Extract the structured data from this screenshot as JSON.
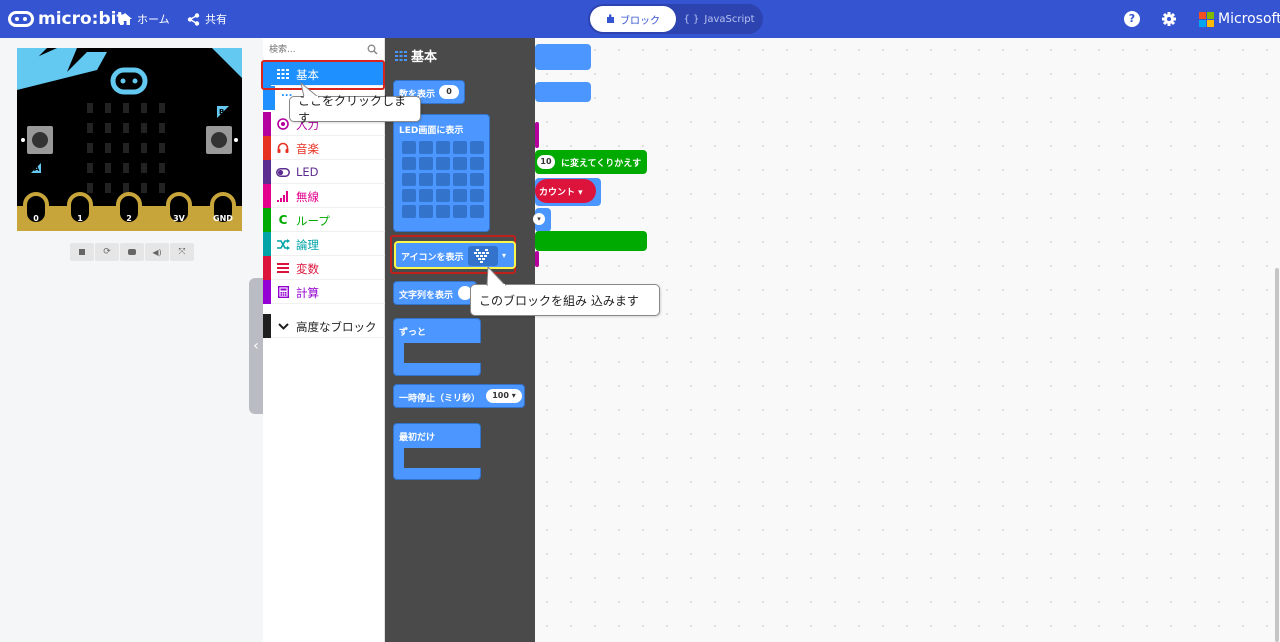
{
  "colors": {
    "topbar": "#3454d1",
    "basic": "#1e90ff",
    "input": "#b4009e",
    "music": "#e63022",
    "led": "#5c2d91",
    "radio": "#e3008c",
    "loops": "#00aa00",
    "logic": "#00a4a6",
    "variables": "#dc143c",
    "math": "#9400d3",
    "advanced": "#1f1f1f",
    "highlight": "#d9231f"
  },
  "header": {
    "logo": "micro:bit",
    "home_label": "ホーム",
    "share_label": "共有",
    "mode_blocks": "ブロック",
    "mode_js": "JavaScript",
    "brand": "Microsoft"
  },
  "simulator": {
    "pin_labels": [
      "0",
      "1",
      "2",
      "3V",
      "GND"
    ],
    "button_a": "A",
    "button_b": "B",
    "controls": [
      "stop-icon",
      "restart-icon",
      "debug-icon",
      "mute-icon",
      "fullscreen-icon"
    ]
  },
  "toolbox": {
    "search_placeholder": "検索...",
    "categories": [
      {
        "label": "基本",
        "icon": "grid-icon",
        "color": "#1e90ff"
      },
      {
        "label": "入力",
        "icon": "target-icon",
        "color": "#b4009e"
      },
      {
        "label": "音楽",
        "icon": "headphones-icon",
        "color": "#e63022"
      },
      {
        "label": "LED",
        "icon": "toggle-icon",
        "color": "#5c2d91"
      },
      {
        "label": "無線",
        "icon": "signal-icon",
        "color": "#e3008c"
      },
      {
        "label": "ループ",
        "icon": "refresh-icon",
        "color": "#00aa00"
      },
      {
        "label": "論理",
        "icon": "shuffle-icon",
        "color": "#00a4a6"
      },
      {
        "label": "変数",
        "icon": "list-icon",
        "color": "#dc143c"
      },
      {
        "label": "計算",
        "icon": "calculator-icon",
        "color": "#9400d3"
      },
      {
        "label": "高度なブロック",
        "icon": "chevron-down-icon",
        "color": "#1f1f1f"
      }
    ],
    "more_label": "..."
  },
  "flyout": {
    "title": "基本",
    "blocks": {
      "show_number": "数を表示",
      "show_number_value": "0",
      "show_leds": "LED画面に表示",
      "show_icon": "アイコンを表示",
      "show_string": "文字列を表示",
      "forever": "ずっと",
      "pause": "一時停止（ミリ秒）",
      "pause_value": "100",
      "on_start": "最初だけ"
    }
  },
  "workspace": {
    "change_text": "に変えてくりかえす",
    "change_value": "10",
    "count_label": "カウント"
  },
  "callouts": {
    "click_here": "ここをクリックします",
    "insert_block": "このブロックを組み 込みます"
  }
}
